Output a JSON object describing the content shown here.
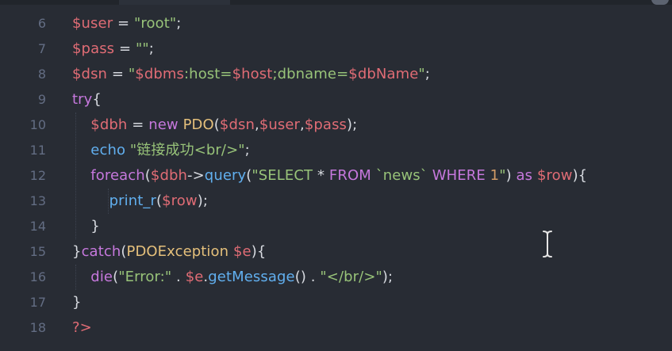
{
  "editor": {
    "lines": [
      {
        "number": "6",
        "tokens": [
          {
            "cls": "var",
            "text": "$user"
          },
          {
            "cls": "op",
            "text": " = "
          },
          {
            "cls": "str",
            "text": "\"root\""
          },
          {
            "cls": "op",
            "text": ";"
          }
        ]
      },
      {
        "number": "7",
        "tokens": [
          {
            "cls": "var",
            "text": "$pass"
          },
          {
            "cls": "op",
            "text": " = "
          },
          {
            "cls": "str",
            "text": "\"\""
          },
          {
            "cls": "op",
            "text": ";"
          }
        ]
      },
      {
        "number": "8",
        "tokens": [
          {
            "cls": "var",
            "text": "$dsn"
          },
          {
            "cls": "op",
            "text": " = "
          },
          {
            "cls": "str",
            "text": "\""
          },
          {
            "cls": "var",
            "text": "$dbms"
          },
          {
            "cls": "str",
            "text": ":host="
          },
          {
            "cls": "var",
            "text": "$host"
          },
          {
            "cls": "str",
            "text": ";dbname="
          },
          {
            "cls": "var",
            "text": "$dbName"
          },
          {
            "cls": "str",
            "text": "\""
          },
          {
            "cls": "op",
            "text": ";"
          }
        ]
      },
      {
        "number": "9",
        "tokens": [
          {
            "cls": "kw",
            "text": "try"
          },
          {
            "cls": "op",
            "text": "{"
          }
        ]
      },
      {
        "number": "10",
        "tokens": [
          {
            "cls": "op",
            "text": "    "
          },
          {
            "cls": "var",
            "text": "$dbh"
          },
          {
            "cls": "op",
            "text": " = "
          },
          {
            "cls": "kw",
            "text": "new"
          },
          {
            "cls": "op",
            "text": " "
          },
          {
            "cls": "cls",
            "text": "PDO"
          },
          {
            "cls": "op",
            "text": "("
          },
          {
            "cls": "var",
            "text": "$dsn"
          },
          {
            "cls": "op",
            "text": ","
          },
          {
            "cls": "var",
            "text": "$user"
          },
          {
            "cls": "op",
            "text": ","
          },
          {
            "cls": "var",
            "text": "$pass"
          },
          {
            "cls": "op",
            "text": ");"
          }
        ]
      },
      {
        "number": "11",
        "tokens": [
          {
            "cls": "op",
            "text": "    "
          },
          {
            "cls": "fn",
            "text": "echo"
          },
          {
            "cls": "op",
            "text": " "
          },
          {
            "cls": "str",
            "text": "\"链接成功<br/>\""
          },
          {
            "cls": "op",
            "text": ";"
          }
        ]
      },
      {
        "number": "12",
        "tokens": [
          {
            "cls": "op",
            "text": "    "
          },
          {
            "cls": "kw",
            "text": "foreach"
          },
          {
            "cls": "op",
            "text": "("
          },
          {
            "cls": "var",
            "text": "$dbh"
          },
          {
            "cls": "op",
            "text": "->"
          },
          {
            "cls": "fn",
            "text": "query"
          },
          {
            "cls": "op",
            "text": "("
          },
          {
            "cls": "str",
            "text": "\"SELECT "
          },
          {
            "cls": "op",
            "text": "*"
          },
          {
            "cls": "str",
            "text": " "
          },
          {
            "cls": "kw",
            "text": "FROM"
          },
          {
            "cls": "str",
            "text": " `news` "
          },
          {
            "cls": "kw",
            "text": "WHERE"
          },
          {
            "cls": "str",
            "text": " "
          },
          {
            "cls": "num",
            "text": "1"
          },
          {
            "cls": "str",
            "text": "\""
          },
          {
            "cls": "op",
            "text": ") "
          },
          {
            "cls": "kw",
            "text": "as"
          },
          {
            "cls": "op",
            "text": " "
          },
          {
            "cls": "var",
            "text": "$row"
          },
          {
            "cls": "op",
            "text": "){"
          }
        ]
      },
      {
        "number": "13",
        "tokens": [
          {
            "cls": "op",
            "text": "        "
          },
          {
            "cls": "fn",
            "text": "print_r"
          },
          {
            "cls": "op",
            "text": "("
          },
          {
            "cls": "var",
            "text": "$row"
          },
          {
            "cls": "op",
            "text": ");"
          }
        ]
      },
      {
        "number": "14",
        "tokens": [
          {
            "cls": "op",
            "text": "    }"
          }
        ]
      },
      {
        "number": "15",
        "tokens": [
          {
            "cls": "op",
            "text": "}"
          },
          {
            "cls": "kw",
            "text": "catch"
          },
          {
            "cls": "op",
            "text": "("
          },
          {
            "cls": "cls",
            "text": "PDOException"
          },
          {
            "cls": "op",
            "text": " "
          },
          {
            "cls": "var",
            "text": "$e"
          },
          {
            "cls": "op",
            "text": "){"
          }
        ]
      },
      {
        "number": "16",
        "tokens": [
          {
            "cls": "op",
            "text": "    "
          },
          {
            "cls": "kw",
            "text": "die"
          },
          {
            "cls": "op",
            "text": "("
          },
          {
            "cls": "str",
            "text": "\"Error:\""
          },
          {
            "cls": "op",
            "text": " . "
          },
          {
            "cls": "var",
            "text": "$e"
          },
          {
            "cls": "op",
            "text": "."
          },
          {
            "cls": "fn",
            "text": "getMessage"
          },
          {
            "cls": "op",
            "text": "() . "
          },
          {
            "cls": "str",
            "text": "\"</br/>\""
          },
          {
            "cls": "op",
            "text": ");"
          }
        ]
      },
      {
        "number": "17",
        "tokens": [
          {
            "cls": "op",
            "text": "}"
          }
        ]
      },
      {
        "number": "18",
        "tokens": [
          {
            "cls": "var",
            "text": "?>"
          }
        ]
      }
    ]
  },
  "colors": {
    "background": "#282c34",
    "variable": "#e06c75",
    "string": "#98c379",
    "keyword": "#c678dd",
    "function": "#61afef",
    "class": "#e5c07b",
    "line_number": "#636d83"
  },
  "cursor": {
    "icon": "i-beam-cursor-icon"
  }
}
